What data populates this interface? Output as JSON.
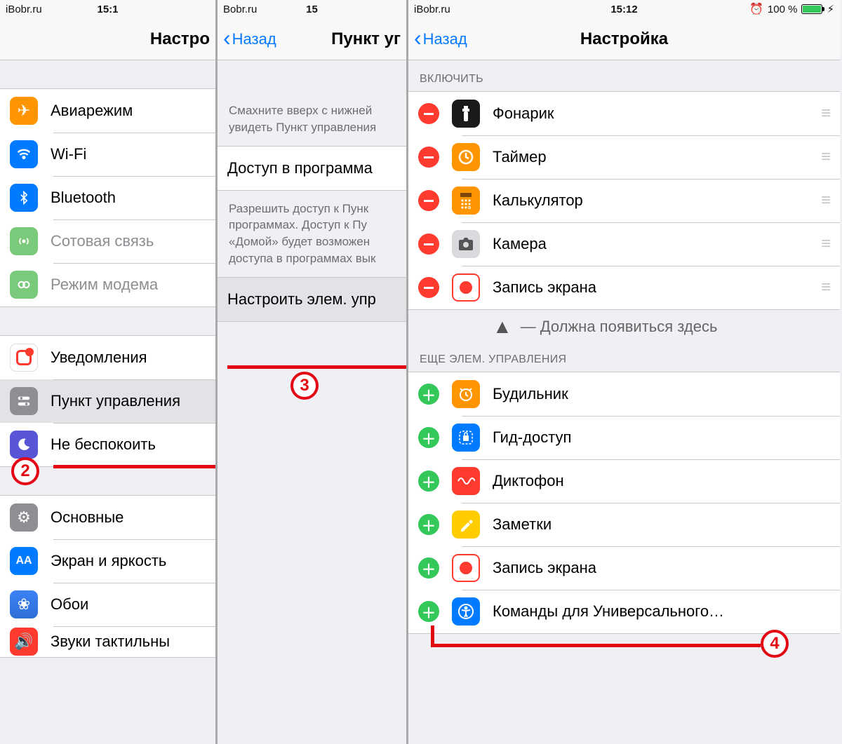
{
  "col1": {
    "status_left": "iBobr.ru",
    "status_time": "15:1",
    "nav_title": "Настро",
    "group1": [
      {
        "label": "Авиарежим",
        "icon": "airplane",
        "color": "i-orange"
      },
      {
        "label": "Wi-Fi",
        "icon": "wifi",
        "color": "i-blue"
      },
      {
        "label": "Bluetooth",
        "icon": "bluetooth",
        "color": "i-blue"
      },
      {
        "label": "Сотовая связь",
        "icon": "cellular",
        "color": "i-greengray",
        "disabled": true
      },
      {
        "label": "Режим модема",
        "icon": "hotspot",
        "color": "i-greengray",
        "disabled": true
      }
    ],
    "group2": [
      {
        "label": "Уведомления",
        "icon": "notifications",
        "color": "i-red"
      },
      {
        "label": "Пункт управления",
        "icon": "control-center",
        "color": "i-gray",
        "highlight": true
      },
      {
        "label": "Не беспокоить",
        "icon": "dnd",
        "color": "i-purple"
      }
    ],
    "group3": [
      {
        "label": "Основные",
        "icon": "general",
        "color": "i-gray"
      },
      {
        "label": "Экран и яркость",
        "icon": "display",
        "color": "i-blue"
      },
      {
        "label": "Обои",
        "icon": "wallpaper",
        "color": "i-bluestripe"
      },
      {
        "label": "Звуки  тактильны",
        "icon": "sounds",
        "color": "i-red"
      }
    ],
    "step": "2"
  },
  "col2": {
    "status_left": "Bobr.ru",
    "status_time": "15",
    "back": "Назад",
    "nav_title": "Пункт уг",
    "note1": "Смахните вверх с нижней увидеть Пункт управления",
    "row_access": "Доступ в программа",
    "note2": "Разрешить доступ к Пунк программах. Доступ к Пу «Домой» будет возможен доступа в программах вык",
    "row_customize": "Настроить элем. упр",
    "step": "3"
  },
  "col3": {
    "status_left": "iBobr.ru",
    "status_time": "15:12",
    "battery_pct": "100 %",
    "back": "Назад",
    "nav_title": "Настройка",
    "section_include": "ВКЛЮЧИТЬ",
    "include_items": [
      {
        "label": "Фонарик",
        "icon": "flashlight",
        "color": "i-dark"
      },
      {
        "label": "Таймер",
        "icon": "timer",
        "color": "i-orange"
      },
      {
        "label": "Калькулятор",
        "icon": "calculator",
        "color": "i-orange"
      },
      {
        "label": "Камера",
        "icon": "camera",
        "color": "i-lightgray"
      },
      {
        "label": "Запись экрана",
        "icon": "screen-record",
        "color": "i-record"
      }
    ],
    "annotation": "Должна появиться здесь",
    "section_more": "ЕЩЕ ЭЛЕМ. УПРАВЛЕНИЯ",
    "more_items": [
      {
        "label": "Будильник",
        "icon": "alarm",
        "color": "i-orange"
      },
      {
        "label": "Гид-доступ",
        "icon": "guided-access",
        "color": "i-blue"
      },
      {
        "label": "Диктофон",
        "icon": "voice-memos",
        "color": "i-redwave"
      },
      {
        "label": "Заметки",
        "icon": "notes",
        "color": "i-yellow"
      },
      {
        "label": "Запись экрана",
        "icon": "screen-record",
        "color": "i-record"
      },
      {
        "label": "Команды для Универсального…",
        "icon": "accessibility",
        "color": "i-blue"
      }
    ],
    "step": "4"
  }
}
